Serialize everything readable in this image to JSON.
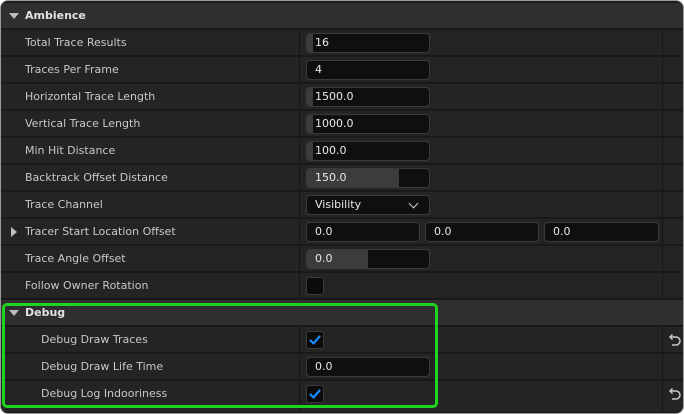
{
  "sections": {
    "ambience_title": "Ambience",
    "debug_title": "Debug"
  },
  "properties": {
    "total_trace_results": {
      "label": "Total Trace Results",
      "value": "16",
      "slider_fraction": 0.05
    },
    "traces_per_frame": {
      "label": "Traces Per Frame",
      "value": "4"
    },
    "horizontal_trace_length": {
      "label": "Horizontal Trace Length",
      "value": "1500.0",
      "slider_fraction": 0.05
    },
    "vertical_trace_length": {
      "label": "Vertical Trace Length",
      "value": "1000.0",
      "slider_fraction": 0.05
    },
    "min_hit_distance": {
      "label": "Min Hit Distance",
      "value": "100.0",
      "slider_fraction": 0.05
    },
    "backtrack_offset_distance": {
      "label": "Backtrack Offset Distance",
      "value": "150.0",
      "slider_fraction": 0.75
    },
    "trace_channel": {
      "label": "Trace Channel",
      "value": "Visibility"
    },
    "tracer_start_location_offset": {
      "label": "Tracer Start Location Offset",
      "x": "0.0",
      "y": "0.0",
      "z": "0.0"
    },
    "trace_angle_offset": {
      "label": "Trace Angle Offset",
      "value": "0.0",
      "slider_fraction": 0.5
    },
    "follow_owner_rotation": {
      "label": "Follow Owner Rotation",
      "checked": false
    }
  },
  "debug": {
    "debug_draw_traces": {
      "label": "Debug Draw Traces",
      "checked": true
    },
    "debug_draw_life_time": {
      "label": "Debug Draw Life Time",
      "value": "0.0"
    },
    "debug_log_indooriness": {
      "label": "Debug Log Indooriness",
      "checked": true
    }
  },
  "colors": {
    "panel_bg": "#1a1a1a",
    "row_bg": "#242424",
    "header_bg": "#2f2f2f",
    "field_bg": "#0f0f0f",
    "check_accent": "#1a8cff",
    "highlight": "#21d321"
  },
  "icons": {
    "expand": "caret-down-icon",
    "collapsed": "caret-right-icon",
    "dropdown": "chevron-down-icon",
    "reset": "reset-arrow-icon",
    "check": "checkmark-icon"
  }
}
